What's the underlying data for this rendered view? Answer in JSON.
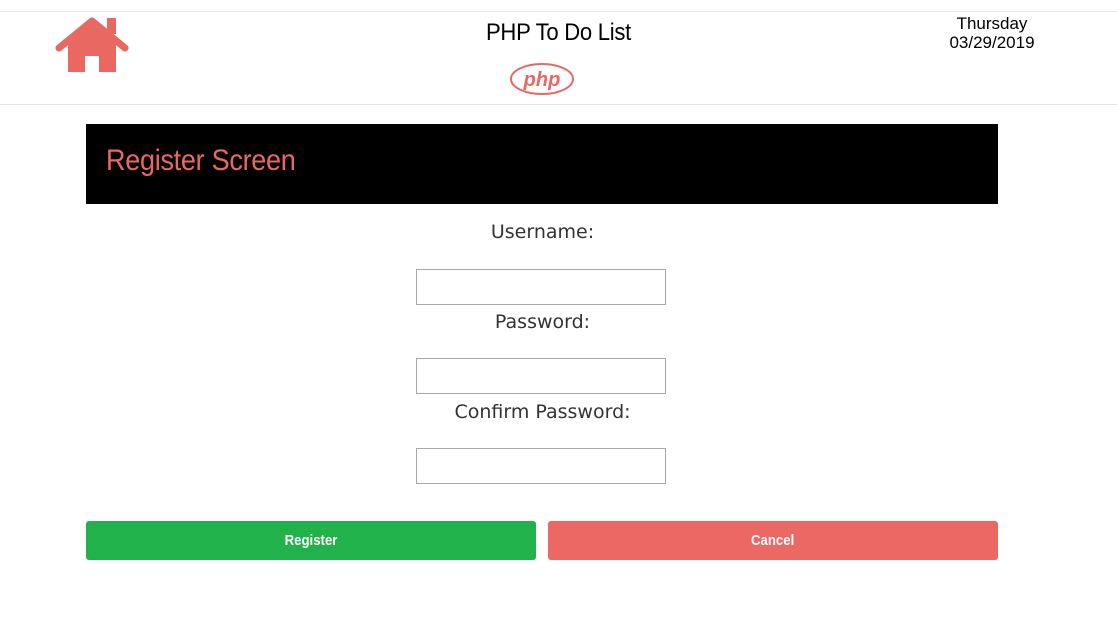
{
  "header": {
    "app_title": "PHP To Do List",
    "logo_text": "php",
    "day": "Thursday",
    "date": "03/29/2019"
  },
  "banner": {
    "title": "Register Screen"
  },
  "form": {
    "username_label": "Username:",
    "username_value": "",
    "password_label": "Password:",
    "password_value": "",
    "confirm_label": "Confirm Password:",
    "confirm_value": ""
  },
  "actions": {
    "register_label": "Register",
    "cancel_label": "Cancel"
  },
  "colors": {
    "accent": "#ea6862",
    "register": "#21b24b",
    "cancel": "#ec6865",
    "banner_bg": "#000000"
  },
  "icons": {
    "home": "home-icon",
    "php_logo": "php-logo"
  }
}
